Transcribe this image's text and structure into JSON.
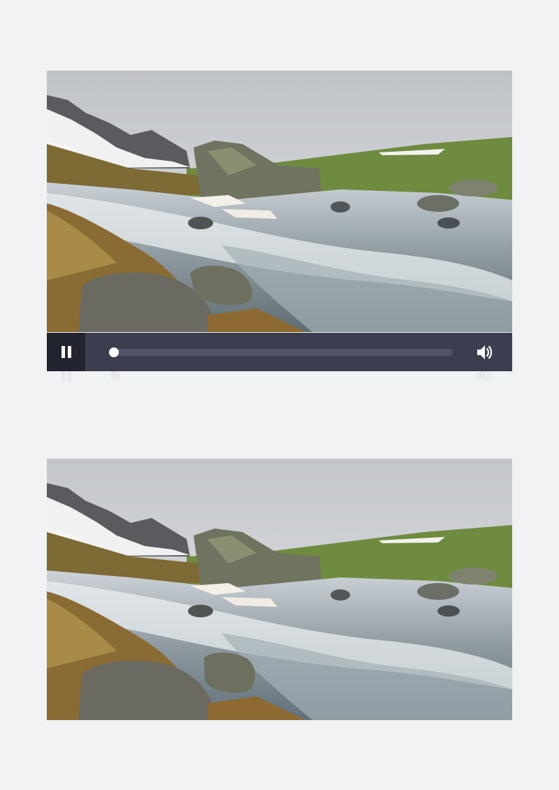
{
  "player": {
    "state": "paused-button-shown",
    "control_icon": "pause-icon",
    "progress_fraction": 0.0,
    "volume_icon": "volume-icon",
    "scene": "mountain-stream-snowy-peaks"
  },
  "still": {
    "scene": "mountain-stream-snowy-peaks"
  },
  "colors": {
    "page_background": "#f1f2f4",
    "control_bar": "#3a3e4e",
    "pause_button_bg": "#22252f",
    "track": "#4f5468",
    "knob": "#ffffff"
  }
}
